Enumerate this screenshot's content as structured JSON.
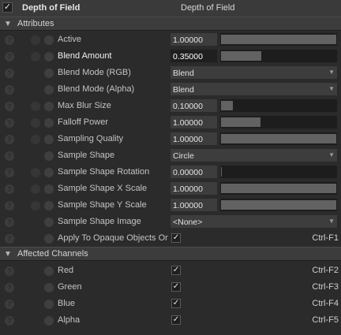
{
  "header": {
    "plugin_label": "Depth of Field",
    "title": "Depth of Field",
    "checkmark": "✓"
  },
  "sections": {
    "attributes": "Attributes",
    "affected_channels": "Affected Channels"
  },
  "attributes": [
    {
      "key": "active",
      "label": "Active",
      "value": "1.00000",
      "slider_fraction": 1.0
    },
    {
      "key": "blend_amount",
      "label": "Blend Amount",
      "value": "0.35000",
      "slider_fraction": 0.35
    },
    {
      "key": "blend_mode_rgb",
      "label": "Blend Mode (RGB)",
      "option": "Blend"
    },
    {
      "key": "blend_mode_alpha",
      "label": "Blend Mode (Alpha)",
      "option": "Blend"
    },
    {
      "key": "max_blur_size",
      "label": "Max Blur Size",
      "value": "0.10000",
      "slider_fraction": 0.1
    },
    {
      "key": "falloff_power",
      "label": "Falloff Power",
      "value": "1.00000",
      "slider_fraction": 0.34
    },
    {
      "key": "sampling_quality",
      "label": "Sampling Quality",
      "value": "1.00000",
      "slider_fraction": 1.0
    },
    {
      "key": "sample_shape",
      "label": "Sample Shape",
      "option": "Circle"
    },
    {
      "key": "sample_shape_rotation",
      "label": "Sample Shape Rotation",
      "value": "0.00000",
      "slider_fraction": 0.0
    },
    {
      "key": "sample_shape_x_scale",
      "label": "Sample Shape X Scale",
      "value": "1.00000",
      "slider_fraction": 1.0
    },
    {
      "key": "sample_shape_y_scale",
      "label": "Sample Shape Y Scale",
      "value": "1.00000",
      "slider_fraction": 1.0
    },
    {
      "key": "sample_shape_image",
      "label": "Sample Shape Image",
      "option": "<None>"
    },
    {
      "key": "apply_to_opaque",
      "label": "Apply To Opaque Objects Onl",
      "checked": true,
      "hotkey": "Ctrl-F1"
    }
  ],
  "channels": [
    {
      "label": "Red",
      "checked": true,
      "hotkey": "Ctrl-F2"
    },
    {
      "label": "Green",
      "checked": true,
      "hotkey": "Ctrl-F3"
    },
    {
      "label": "Blue",
      "checked": true,
      "hotkey": "Ctrl-F4"
    },
    {
      "label": "Alpha",
      "checked": true,
      "hotkey": "Ctrl-F5"
    }
  ],
  "glyphs": {
    "help": "?",
    "check": "✓",
    "dropdown": "▼",
    "expanded": "▼"
  },
  "colors": {
    "panel_bg": "#2b2b2b",
    "field_bg": "#3d3d3d",
    "slider_fill": "#626262",
    "active_field_bg": "#1f1f1f"
  }
}
